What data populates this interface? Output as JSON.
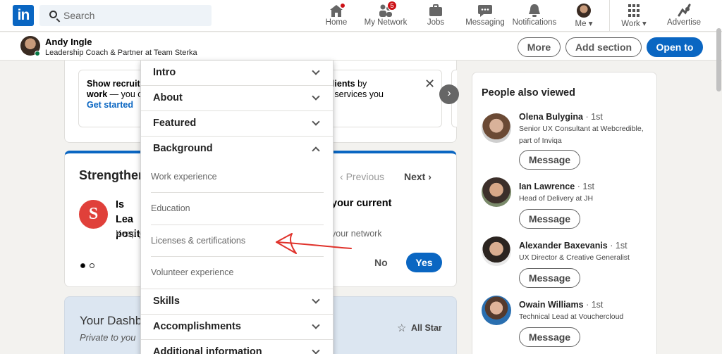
{
  "nav": {
    "logo": "in",
    "search_placeholder": "Search",
    "items": [
      {
        "label": "Home",
        "icon": "home-icon"
      },
      {
        "label": "My Network",
        "icon": "network-icon",
        "badge": "5"
      },
      {
        "label": "Jobs",
        "icon": "briefcase-icon"
      },
      {
        "label": "Messaging",
        "icon": "chat-icon"
      },
      {
        "label": "Notifications",
        "icon": "bell-icon"
      },
      {
        "label": "Me",
        "icon": "avatar"
      },
      {
        "label": "Work",
        "icon": "grid-icon"
      },
      {
        "label": "Advertise",
        "icon": "compass-icon"
      }
    ]
  },
  "profile_bar": {
    "name": "Andy Ingle",
    "headline": "Leadership Coach & Partner at Team Sterka",
    "more": "More",
    "add_section": "Add section",
    "open_to": "Open to"
  },
  "promo": {
    "left_bold": "Show recruite",
    "left_line2_bold": "work",
    "left_line2": " — you c",
    "cta": "Get started",
    "right_bold": "clients",
    "right_line1": " by",
    "right_line2": "e services you"
  },
  "strengthen": {
    "title": "Strengthen",
    "previous": "Previous",
    "next": "Next",
    "q_left_1": "Is Lea",
    "q_left_2": "positi",
    "q_right": "your current",
    "keep_left": "Keep y",
    "keep_right": "your network",
    "no": "No",
    "yes": "Yes",
    "logo_letter": "S"
  },
  "dashboard": {
    "title": "Your Dashb",
    "subtitle": "Private to you",
    "all_star": "All Star"
  },
  "people_also_viewed": {
    "title": "People also viewed",
    "message_label": "Message",
    "people": [
      {
        "name": "Olena Bulygina",
        "degree": "· 1st",
        "headline": "Senior UX Consultant at Webcredible, part of Inviqa"
      },
      {
        "name": "Ian Lawrence",
        "degree": "· 1st",
        "headline": "Head of Delivery at JH"
      },
      {
        "name": "Alexander Baxevanis",
        "degree": "· 1st",
        "headline": "UX Director & Creative Generalist"
      },
      {
        "name": "Owain Williams",
        "degree": "· 1st",
        "headline": "Technical Lead at Vouchercloud"
      }
    ]
  },
  "add_section_menu": {
    "intro": "Intro",
    "about": "About",
    "featured": "Featured",
    "background": "Background",
    "background_items": [
      "Work experience",
      "Education",
      "Licenses & certifications",
      "Volunteer experience"
    ],
    "skills": "Skills",
    "accomplishments": "Accomplishments",
    "additional": "Additional information"
  },
  "colors": {
    "brand": "#0a66c2",
    "badge": "#cc1016",
    "annotation_arrow": "#e0322b"
  }
}
